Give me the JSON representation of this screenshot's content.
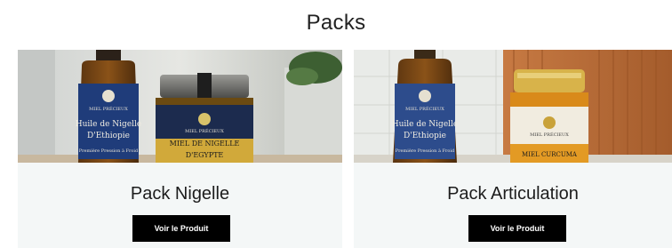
{
  "section": {
    "title": "Packs"
  },
  "products": [
    {
      "name": "Pack Nigelle",
      "button_label": "Voir le Produit",
      "image": {
        "bottle_brand": "MIEL PRÉCIEUX",
        "bottle_text_1": "Huile de Nigelle",
        "bottle_text_2": "D'Ethiopie",
        "bottle_text_3": "Première Pression à Froid",
        "jar_brand": "MIEL PRÉCIEUX",
        "jar_text_1": "MIEL DE NIGELLE",
        "jar_text_2": "D'EGYPTE"
      }
    },
    {
      "name": "Pack Articulation",
      "button_label": "Voir le Produit",
      "image": {
        "bottle_brand": "MIEL PRÉCIEUX",
        "bottle_text_1": "Huile de Nigelle",
        "bottle_text_2": "D'Ethiopie",
        "bottle_text_3": "Première Pression à Froid",
        "jar_brand": "MIEL PRÉCIEUX",
        "jar_text_1": "MIEL CURCUMA"
      }
    }
  ]
}
